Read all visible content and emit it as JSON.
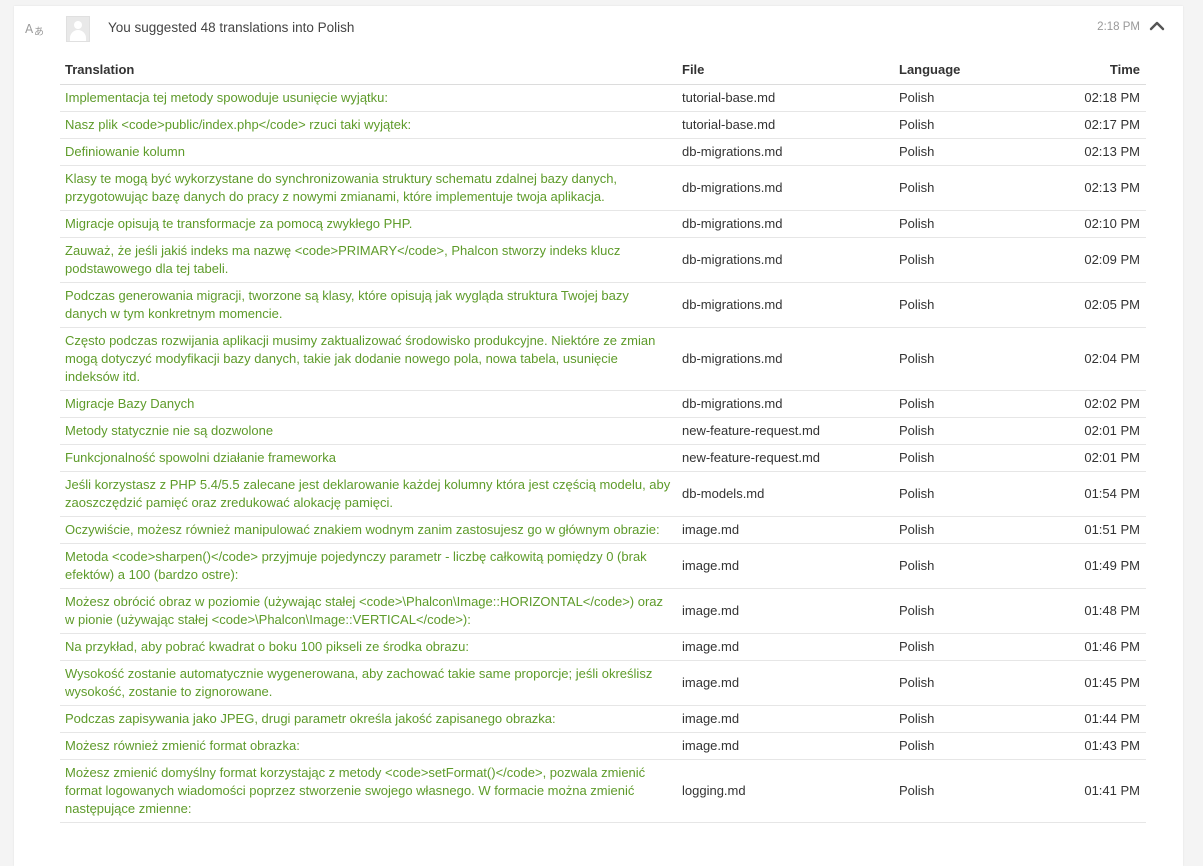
{
  "header": {
    "icon": "translate-icon",
    "avatar_icon": "user-avatar-icon",
    "title": "You suggested 48 translations into Polish",
    "time": "2:18 PM",
    "collapse_icon": "chevron-up-icon"
  },
  "table": {
    "headers": {
      "translation": "Translation",
      "file": "File",
      "language": "Language",
      "time": "Time"
    },
    "rows": [
      {
        "translation": "Implementacja tej metody spowoduje usunięcie wyjątku:",
        "file": "tutorial-base.md",
        "language": "Polish",
        "time": "02:18 PM"
      },
      {
        "translation": "Nasz plik <code>public/index.php</code> rzuci taki wyjątek:",
        "file": "tutorial-base.md",
        "language": "Polish",
        "time": "02:17 PM"
      },
      {
        "translation": "Definiowanie kolumn",
        "file": "db-migrations.md",
        "language": "Polish",
        "time": "02:13 PM"
      },
      {
        "translation": "Klasy te mogą być wykorzystane do synchronizowania struktury schematu zdalnej bazy danych, przygotowując bazę danych do pracy z nowymi zmianami, które implementuje twoja aplikacja.",
        "file": "db-migrations.md",
        "language": "Polish",
        "time": "02:13 PM"
      },
      {
        "translation": "Migracje opisują te transformacje za pomocą zwykłego PHP.",
        "file": "db-migrations.md",
        "language": "Polish",
        "time": "02:10 PM"
      },
      {
        "translation": "Zauważ, że jeśli jakiś indeks ma nazwę <code>PRIMARY</code>, Phalcon stworzy indeks klucz podstawowego dla tej tabeli.",
        "file": "db-migrations.md",
        "language": "Polish",
        "time": "02:09 PM"
      },
      {
        "translation": "Podczas generowania migracji, tworzone są klasy, które opisują jak wygląda struktura Twojej bazy danych w tym konkretnym momencie.",
        "file": "db-migrations.md",
        "language": "Polish",
        "time": "02:05 PM"
      },
      {
        "translation": "Często podczas rozwijania aplikacji musimy zaktualizować środowisko produkcyjne. Niektóre ze zmian mogą dotyczyć modyfikacji bazy danych, takie jak dodanie nowego pola, nowa tabela, usunięcie indeksów itd.",
        "file": "db-migrations.md",
        "language": "Polish",
        "time": "02:04 PM"
      },
      {
        "translation": "Migracje Bazy Danych",
        "file": "db-migrations.md",
        "language": "Polish",
        "time": "02:02 PM"
      },
      {
        "translation": "Metody statycznie nie są dozwolone",
        "file": "new-feature-request.md",
        "language": "Polish",
        "time": "02:01 PM"
      },
      {
        "translation": "Funkcjonalność spowolni działanie frameworka",
        "file": "new-feature-request.md",
        "language": "Polish",
        "time": "02:01 PM"
      },
      {
        "translation": "Jeśli korzystasz z PHP 5.4/5.5 zalecane jest deklarowanie każdej kolumny która jest częścią modelu, aby zaoszczędzić pamięć oraz zredukować alokację pamięci.",
        "file": "db-models.md",
        "language": "Polish",
        "time": "01:54 PM"
      },
      {
        "translation": "Oczywiście, możesz również manipulować znakiem wodnym zanim zastosujesz go w głównym obrazie:",
        "file": "image.md",
        "language": "Polish",
        "time": "01:51 PM"
      },
      {
        "translation": "Metoda <code>sharpen()</code> przyjmuje pojedynczy parametr - liczbę całkowitą pomiędzy 0 (brak efektów) a 100 (bardzo ostre):",
        "file": "image.md",
        "language": "Polish",
        "time": "01:49 PM"
      },
      {
        "translation": "Możesz obrócić obraz w poziomie (używając stałej <code>\\Phalcon\\Image::HORIZONTAL</code>) oraz w pionie (używając stałej <code>\\Phalcon\\Image::VERTICAL</code>):",
        "file": "image.md",
        "language": "Polish",
        "time": "01:48 PM"
      },
      {
        "translation": "Na przykład, aby pobrać kwadrat o boku 100 pikseli ze środka obrazu:",
        "file": "image.md",
        "language": "Polish",
        "time": "01:46 PM"
      },
      {
        "translation": "Wysokość zostanie automatycznie wygenerowana, aby zachować takie same proporcje; jeśli określisz wysokość, zostanie to zignorowane.",
        "file": "image.md",
        "language": "Polish",
        "time": "01:45 PM"
      },
      {
        "translation": "Podczas zapisywania jako JPEG, drugi parametr określa jakość zapisanego obrazka:",
        "file": "image.md",
        "language": "Polish",
        "time": "01:44 PM"
      },
      {
        "translation": "Możesz również zmienić format obrazka:",
        "file": "image.md",
        "language": "Polish",
        "time": "01:43 PM"
      },
      {
        "translation": "Możesz zmienić domyślny format korzystając z metody <code>setFormat()</code>, pozwala zmienić format logowanych wiadomości poprzez stworzenie swojego własnego. W formacie można zmienić następujące zmienne:",
        "file": "logging.md",
        "language": "Polish",
        "time": "01:41 PM"
      }
    ]
  }
}
